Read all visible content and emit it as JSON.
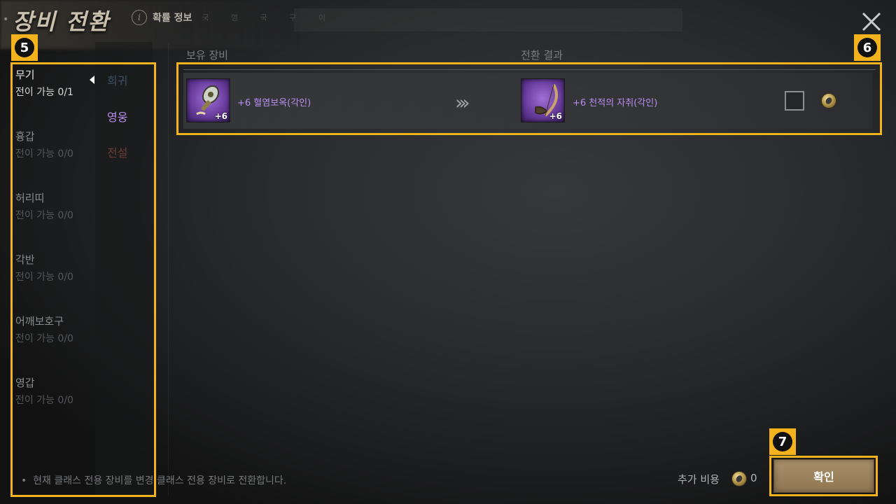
{
  "header": {
    "title": "장비 전환",
    "info_label": "확률 정보",
    "faded_tabs": "국 영 국 구 이"
  },
  "badges": {
    "left": "5",
    "right": "6",
    "bottom": "7"
  },
  "categories": [
    {
      "name": "무기",
      "status": "전이 가능 0/1"
    },
    {
      "name": "흉갑",
      "status": "전이 가능 0/0"
    },
    {
      "name": "허리띠",
      "status": "전이 가능 0/0"
    },
    {
      "name": "각반",
      "status": "전이 가능 0/0"
    },
    {
      "name": "어깨보호구",
      "status": "전이 가능 0/0"
    },
    {
      "name": "영갑",
      "status": "전이 가능 0/0"
    }
  ],
  "grades": [
    "희귀",
    "영웅",
    "전설"
  ],
  "colors": {
    "grade_rare": "#3d5266",
    "grade_hero": "#b98ef0",
    "grade_legend": "#6b3c33",
    "highlight": "#f4b31c",
    "item_name": "#b98ef0"
  },
  "list": {
    "owned_header": "보유 장비",
    "result_header": "전환 결과",
    "owned_item": {
      "name": "+6 혈염보옥(각인)",
      "level": "+6"
    },
    "result_item": {
      "name": "+6 천적의 자취(각인)",
      "level": "+6"
    }
  },
  "footer": {
    "note": "현재 클래스 전용 장비를 변경 클래스 전용 장비로 전환합니다.",
    "cost_label": "추가 비용",
    "cost_value": "0",
    "confirm_label": "확인"
  },
  "icons": {
    "close": "close-icon",
    "info": "info-icon",
    "coin": "coin-icon",
    "arrow": "chevron-right-icon"
  }
}
